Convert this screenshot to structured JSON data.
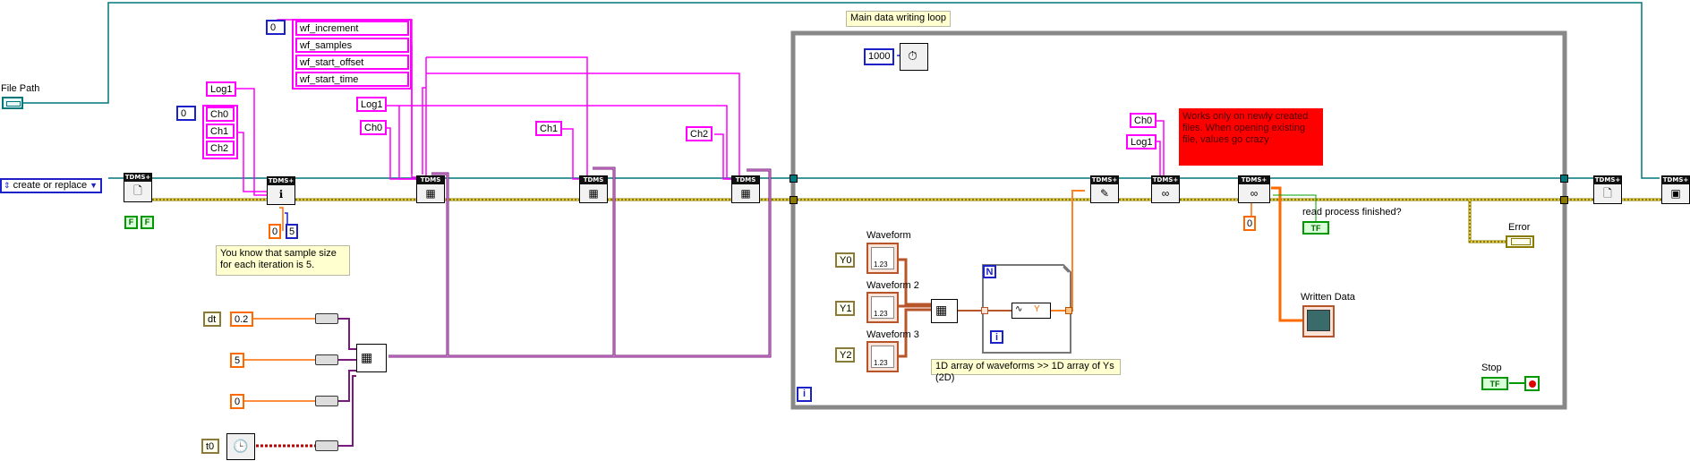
{
  "labels": {
    "file_path": "File Path",
    "main_loop": "Main data writing loop",
    "waveform": "Waveform",
    "waveform2": "Waveform 2",
    "waveform3": "Waveform 3",
    "read_process": "read process finished?",
    "error": "Error",
    "written_data": "Written Data",
    "stop": "Stop"
  },
  "enum_control": {
    "value": "create or replace",
    "arrow": "▼",
    "prefix": "⇕"
  },
  "constants": {
    "zero_top": "0",
    "wf_increment": "wf_increment",
    "wf_samples": "wf_samples",
    "wf_start_offset": "wf_start_offset",
    "wf_start_time": "wf_start_time",
    "log1_a": "Log1",
    "zero_ch": "0",
    "ch0_a": "Ch0",
    "ch1_a": "Ch1",
    "ch2_a": "Ch2",
    "log1_b": "Log1",
    "ch0_b": "Ch0",
    "ch1_b": "Ch1",
    "ch2_b": "Ch2",
    "zero_o": "0",
    "five_b": "5",
    "loop_1000": "1000",
    "ch0_c": "Ch0",
    "log1_c": "Log1",
    "zero_d": "0",
    "dt": "dt",
    "v02": "0.2",
    "v5": "5",
    "v0": "0",
    "t0": "t0",
    "y0": "Y0",
    "y1": "Y1",
    "y2": "Y2",
    "y_unbundle": "Y",
    "bool_f1": "F",
    "bool_f2": "F"
  },
  "comments": {
    "sample_size": "You know that sample size for each iteration is 5.",
    "works_only": "Works only on newly created files. When opening existing file, values go crazy",
    "array_note": "1D array of waveforms  >> 1D array of Ys (2D)"
  },
  "tdms": {
    "header": "TDMS",
    "plus": "+"
  },
  "terminals": {
    "loop_i": "i",
    "for_n": "N",
    "for_i": "i",
    "tf": "TF",
    "wf_num": "1.23"
  },
  "colors": {
    "string_wire": "#ff00ff",
    "numeric_dbl": "#ff6a00",
    "numeric_int": "#1a22c8",
    "refnum_wire": "#00777a",
    "error_wire": "#c8b400",
    "cluster_wire": "#7a1a7a",
    "bool_wire": "#009900",
    "waveform_wire": "#b8542a",
    "loop_border": "#888888",
    "red_comment": "#ff0000"
  }
}
